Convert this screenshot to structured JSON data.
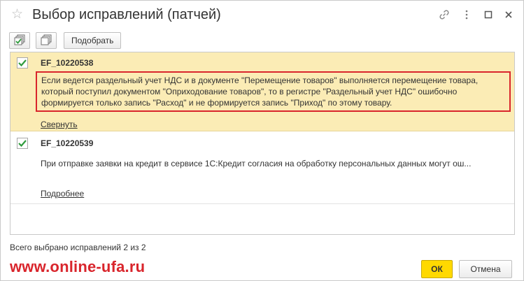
{
  "window": {
    "title": "Выбор исправлений (патчей)"
  },
  "toolbar": {
    "select_all_icon": "check-all-icon",
    "copy_icon": "copy-icon",
    "pick_label": "Подобрать"
  },
  "list": {
    "items": [
      {
        "code": "EF_10220538",
        "checked": true,
        "selected": true,
        "description": "Если ведется раздельный учет НДС и в документе \"Перемещение товаров\" выполняется перемещение товара, который поступил документом \"Оприходование товаров\", то в регистре \"Раздельный учет НДС\" ошибочно формируется только запись \"Расход\" и не формируется запись \"Приход\" по этому товару.",
        "link": "Свернуть"
      },
      {
        "code": "EF_10220539",
        "checked": true,
        "selected": false,
        "description": "При отправке заявки на кредит в сервисе 1С:Кредит согласия на обработку персональных данных могут ош...",
        "link": "Подробнее"
      }
    ]
  },
  "footer": {
    "status": "Всего выбрано исправлений 2 из 2",
    "watermark": "www.online-ufa.ru",
    "ok_label": "ОК",
    "cancel_label": "Отмена"
  },
  "colors": {
    "selected_row": "#fbecb5",
    "highlight_border": "#d9252c",
    "ok_button": "#ffd900",
    "check": "#2f9b3d"
  }
}
